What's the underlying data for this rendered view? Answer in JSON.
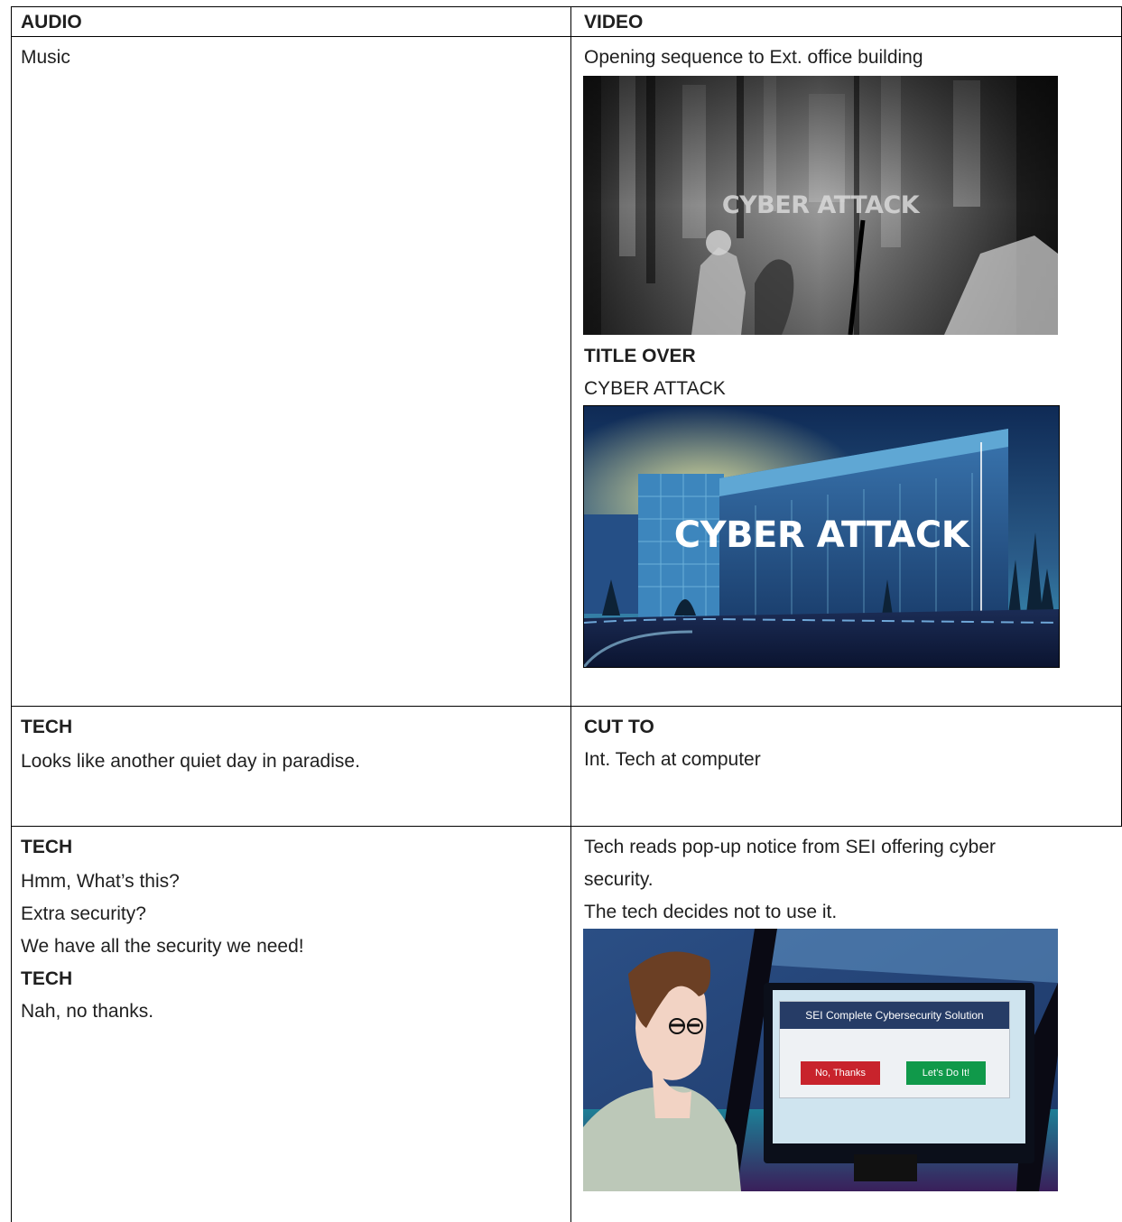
{
  "columns": {
    "audio": "AUDIO",
    "video": "VIDEO"
  },
  "rows": [
    {
      "audio": {
        "lines": [
          "Music"
        ]
      },
      "video": {
        "line1": "Opening sequence to Ext. office building",
        "frame1_overlay": "CYBER ATTACK",
        "heading": "TITLE OVER",
        "line2": "CYBER ATTACK",
        "frame2_overlay": "CYBER ATTACK"
      }
    },
    {
      "audio": {
        "speaker": "TECH",
        "line": "Looks like another quiet day in paradise."
      },
      "video": {
        "heading": "CUT TO",
        "line": "Int. Tech at computer"
      }
    },
    {
      "audio": {
        "speaker": "TECH",
        "lines": [
          "Hmm, What’s this?",
          "Extra security?",
          "We have all the security we need!"
        ],
        "speaker2": "TECH",
        "line2": "Nah, no thanks."
      },
      "video": {
        "line1": "Tech reads pop-up notice from SEI offering cyber",
        "line1b": "security.",
        "line2": "The tech decides not to use it.",
        "popup_title": "SEI Complete Cybersecurity Solution",
        "decline_label": "No, Thanks",
        "accept_label": "Let’s Do It!"
      }
    }
  ],
  "colors": {
    "decline": "#c8232c",
    "accept": "#10994a",
    "popup_bar": "#263c66"
  }
}
